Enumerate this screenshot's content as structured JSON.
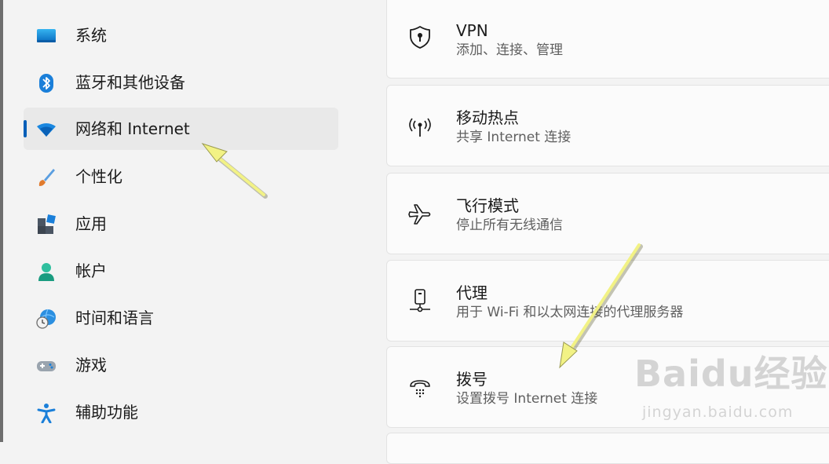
{
  "sidebar": {
    "items": [
      {
        "label": "系统",
        "icon": "monitor-icon"
      },
      {
        "label": "蓝牙和其他设备",
        "icon": "bluetooth-icon"
      },
      {
        "label": "网络和 Internet",
        "icon": "wifi-icon",
        "selected": true
      },
      {
        "label": "个性化",
        "icon": "paintbrush-icon"
      },
      {
        "label": "应用",
        "icon": "apps-icon"
      },
      {
        "label": "帐户",
        "icon": "account-icon"
      },
      {
        "label": "时间和语言",
        "icon": "time-language-icon"
      },
      {
        "label": "游戏",
        "icon": "gamepad-icon"
      },
      {
        "label": "辅助功能",
        "icon": "accessibility-icon"
      }
    ]
  },
  "settings": {
    "cards": [
      {
        "title": "VPN",
        "subtitle": "添加、连接、管理",
        "icon": "shield-icon"
      },
      {
        "title": "移动热点",
        "subtitle": "共享 Internet 连接",
        "icon": "hotspot-icon"
      },
      {
        "title": "飞行模式",
        "subtitle": "停止所有无线通信",
        "icon": "airplane-icon"
      },
      {
        "title": "代理",
        "subtitle": "用于 Wi-Fi 和以太网连接的代理服务器",
        "icon": "proxy-icon"
      },
      {
        "title": "拨号",
        "subtitle": "设置拨号 Internet 连接",
        "icon": "dialup-icon"
      }
    ]
  },
  "watermark": {
    "logo": "Baidu经验",
    "url": "jingyan.baidu.com"
  },
  "colors": {
    "accent": "#005fb8",
    "annotation_arrow": "#f2f285"
  }
}
